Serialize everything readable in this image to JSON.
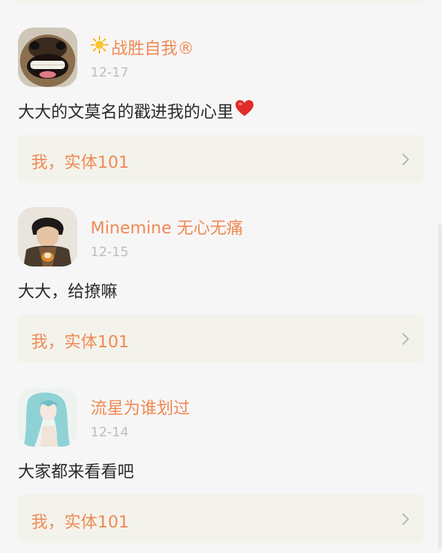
{
  "comments": [
    {
      "user": "战胜自我®",
      "user_prefix_icon": "sun-icon",
      "date": "12-17",
      "text": "大大的文莫名的戳进我的心里",
      "text_suffix_icon": "red-heart-icon",
      "reply": "我，实体101",
      "avatar": "pug-avatar"
    },
    {
      "user": "Minemine 无心无痛",
      "date": "12-15",
      "text": "大大，给撩嘛",
      "reply": "我，实体101",
      "avatar": "young-man-avatar"
    },
    {
      "user": "流星为谁划过",
      "date": "12-14",
      "text": "大家都来看看吧",
      "reply": "我，实体101",
      "avatar": "anime-girl-avatar"
    }
  ],
  "colors": {
    "accent": "#f08a55",
    "background": "#f7f6f6",
    "card": "#f3f3ec",
    "date": "#bdbdbd",
    "text": "#2b2b2b"
  }
}
